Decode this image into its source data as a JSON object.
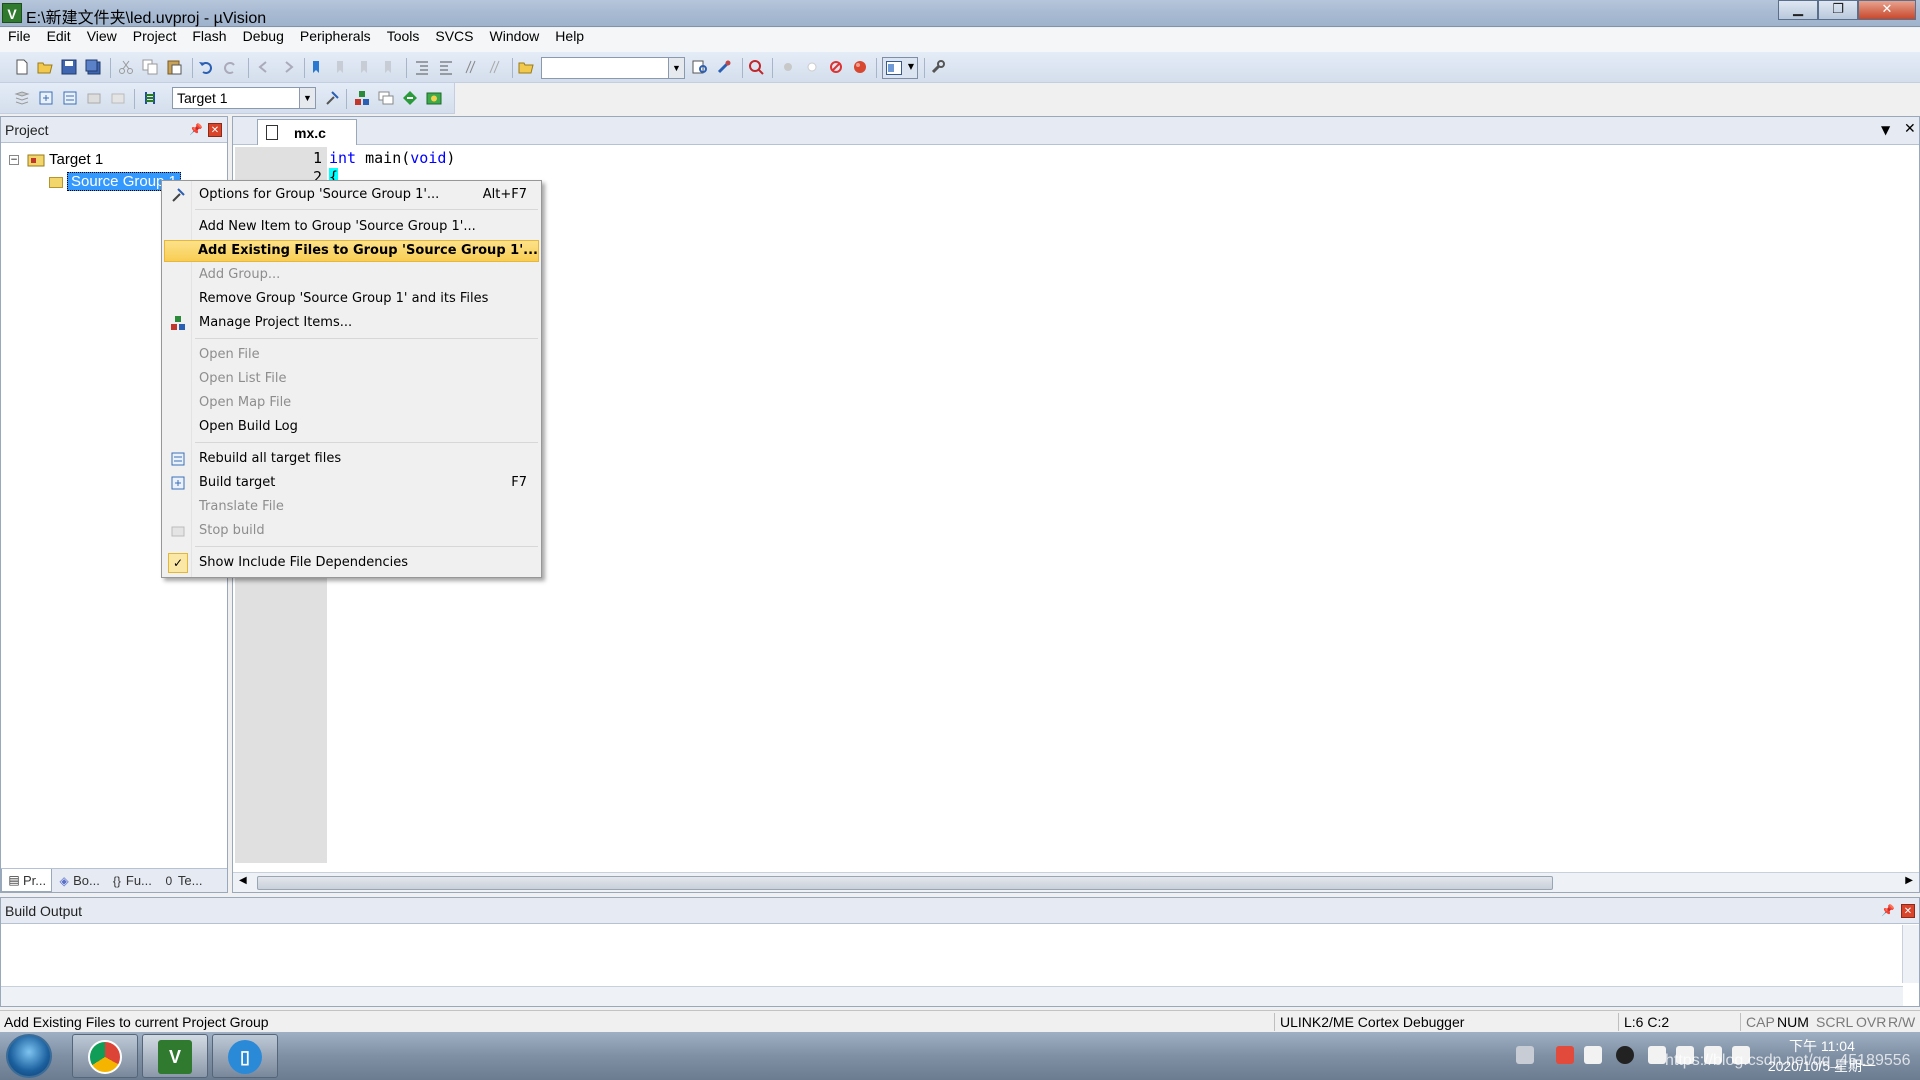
{
  "window": {
    "title": "E:\\新建文件夹\\led.uvproj - µVision",
    "min": "▁",
    "max": "❐",
    "close": "✕"
  },
  "menubar": [
    "File",
    "Edit",
    "View",
    "Project",
    "Flash",
    "Debug",
    "Peripherals",
    "Tools",
    "SVCS",
    "Window",
    "Help"
  ],
  "toolbar": {
    "find_combo": "",
    "target_combo": "Target 1"
  },
  "project_panel": {
    "title": "Project",
    "root": "Target 1",
    "group": "Source Group 1",
    "tabs": [
      "Pr...",
      "Bo...",
      "Fu...",
      "Te..."
    ]
  },
  "editor": {
    "tab": "mx.c",
    "lines": [
      {
        "num": "1",
        "kw1": "int",
        "mid": " main(",
        "kw2": "void",
        "end": ")"
      },
      {
        "num": "2",
        "text": "{"
      }
    ]
  },
  "build_output": {
    "title": "Build Output"
  },
  "status": {
    "message": "Add Existing Files to current Project Group",
    "debugger": "ULINK2/ME Cortex Debugger",
    "position": "L:6 C:2",
    "cap": "CAP",
    "num": "NUM",
    "scrl": "SCRL",
    "ovr": "OVR",
    "rw": "R/W"
  },
  "context_menu": {
    "items": [
      {
        "label": "Options for Group 'Source Group 1'...",
        "shortcut": "Alt+F7",
        "icon": "wrench-icon"
      },
      {
        "label": "Add New  Item to Group 'Source Group 1'...",
        "shortcut": ""
      },
      {
        "label": "Add Existing Files to Group 'Source Group 1'...",
        "shortcut": "",
        "highlighted": true
      },
      {
        "label": "Add Group...",
        "shortcut": "",
        "disabled": true
      },
      {
        "label": "Remove Group 'Source Group 1' and its Files",
        "shortcut": ""
      },
      {
        "label": "Manage Project Items...",
        "shortcut": "",
        "icon": "manage-items-icon"
      },
      {
        "label": "Open File",
        "shortcut": "",
        "disabled": true
      },
      {
        "label": "Open List File",
        "shortcut": "",
        "disabled": true
      },
      {
        "label": "Open Map File",
        "shortcut": "",
        "disabled": true
      },
      {
        "label": "Open Build Log",
        "shortcut": ""
      },
      {
        "label": "Rebuild all target files",
        "shortcut": "",
        "icon": "rebuild-icon"
      },
      {
        "label": "Build target",
        "shortcut": "F7",
        "icon": "build-icon"
      },
      {
        "label": "Translate File",
        "shortcut": "",
        "disabled": true
      },
      {
        "label": "Stop build",
        "shortcut": "",
        "disabled": true,
        "icon": "stop-build-icon"
      },
      {
        "label": "Show Include File Dependencies",
        "shortcut": "",
        "checked": true
      }
    ]
  },
  "taskbar": {
    "clock_time": "下午 11:04",
    "clock_date": "2020/10/5 星期一",
    "watermark": "https://blog.csdn.net/qq_45189556"
  },
  "colors": {
    "selection": "#3399ff",
    "menu_highlight": "#f8cd52",
    "keyword": "#0000ff"
  }
}
